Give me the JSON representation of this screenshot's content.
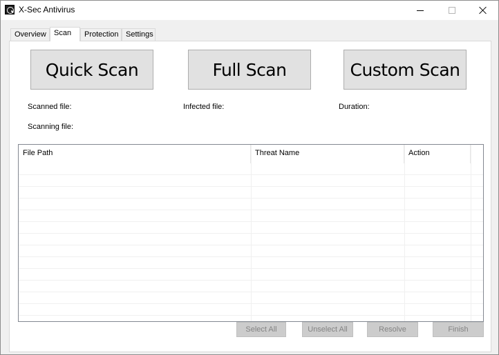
{
  "window": {
    "title": "X-Sec Antivirus",
    "app_icon": "xsec-shield-icon"
  },
  "tabs": [
    {
      "label": "Overview",
      "active": false
    },
    {
      "label": "Scan",
      "active": true
    },
    {
      "label": "Protection",
      "active": false
    },
    {
      "label": "Settings",
      "active": false
    }
  ],
  "scan": {
    "buttons": {
      "quick": "Quick Scan",
      "full": "Full Scan",
      "custom": "Custom Scan"
    },
    "info": {
      "scanned_file": "Scanned file:",
      "infected_file": "Infected file:",
      "duration": "Duration:",
      "scanning_file": "Scanning file:"
    },
    "results_table": {
      "columns": [
        "File Path",
        "Threat Name",
        "Action"
      ],
      "rows": []
    },
    "actions": {
      "select_all": "Select All",
      "unselect_all": "Unselect All",
      "resolve": "Resolve",
      "finish": "Finish"
    }
  },
  "colors": {
    "window_bg": "#f0f0f0",
    "panel_bg": "#ffffff",
    "button_bg": "#e1e1e1",
    "disabled_button_bg": "#cccccc",
    "disabled_text": "#838383"
  }
}
